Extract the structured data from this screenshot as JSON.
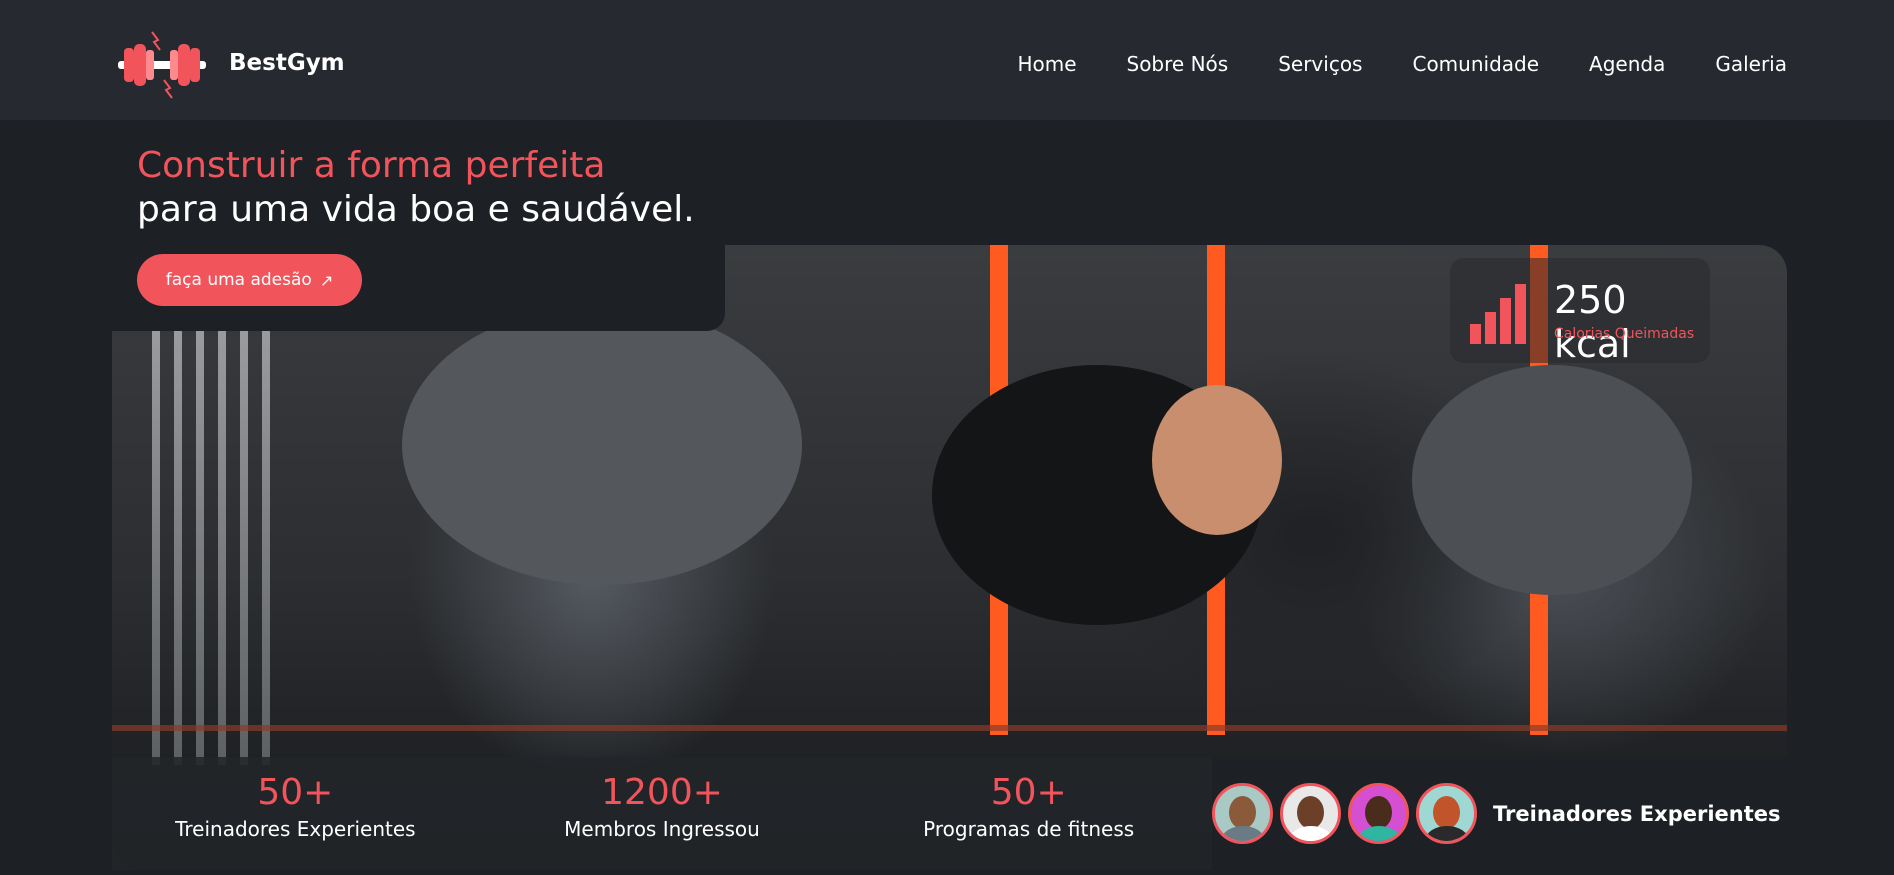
{
  "brand": {
    "name": "BestGym",
    "logo_icon": "dumbbell-icon"
  },
  "nav": {
    "items": [
      "Home",
      "Sobre Nós",
      "Serviços",
      "Comunidade",
      "Agenda",
      "Galeria"
    ]
  },
  "hero": {
    "title_line1": "Construir a forma perfeita",
    "title_line2": "para uma vida boa e saudável.",
    "cta_label": "faça uma adesão",
    "cta_icon": "arrow-up-right-icon"
  },
  "calories": {
    "value": "250 kcal",
    "label": "Calorias Queimadas",
    "icon": "bar-chart-icon"
  },
  "stats": [
    {
      "number": "50+",
      "label": "Treinadores Experientes"
    },
    {
      "number": "1200+",
      "label": "Membros Ingressou"
    },
    {
      "number": "50+",
      "label": "Programas de fitness"
    }
  ],
  "trainers": {
    "label": "Treinadores Experientes",
    "avatar_count": 4
  },
  "colors": {
    "accent": "#f2545b",
    "background": "#1d2126",
    "navbar": "#262a30"
  }
}
